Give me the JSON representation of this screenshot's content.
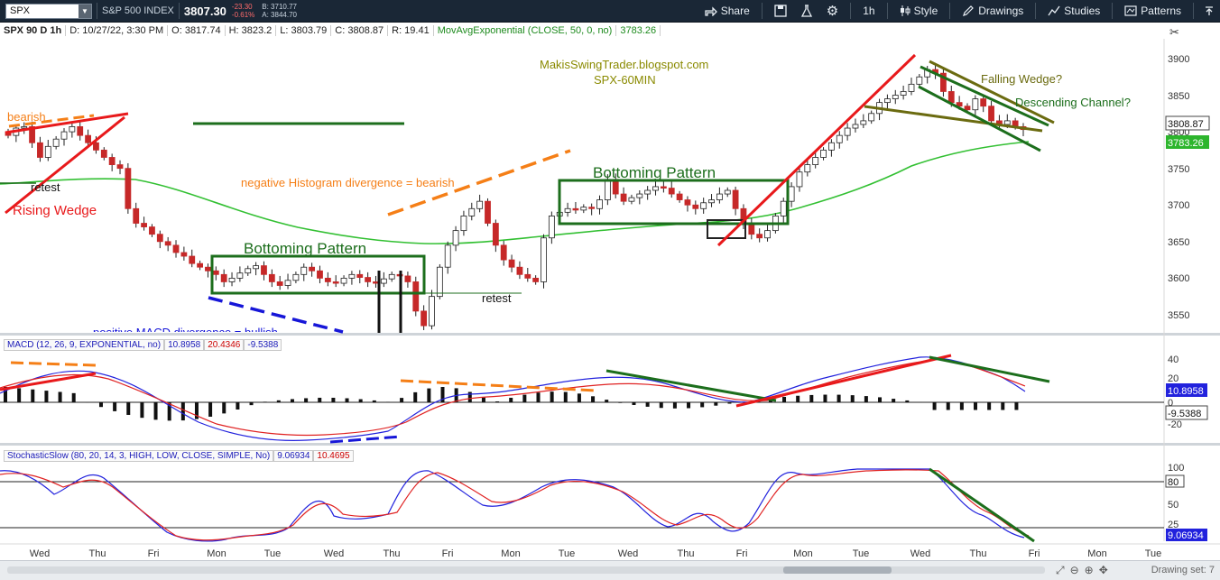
{
  "toolbar": {
    "symbol": "SPX",
    "instrument_name": "S&P 500 INDEX",
    "last_price": "3807.30",
    "change": "-23.30",
    "change_pct": "-0.61%",
    "bid": "B: 3710.77",
    "ask": "A: 3844.70",
    "buttons": {
      "share": "Share",
      "timeframe": "1h",
      "style": "Style",
      "drawings": "Drawings",
      "studies": "Studies",
      "patterns": "Patterns"
    },
    "icons": [
      "share-icon",
      "save-icon",
      "beaker-icon",
      "gear-icon",
      "candles-icon",
      "pencil-icon",
      "studies-icon",
      "patterns-icon",
      "collapse-icon"
    ]
  },
  "header": {
    "chart_spec": "SPX 90 D 1h",
    "date": "D: 10/27/22, 3:30 PM",
    "open": "O: 3817.74",
    "high": "H: 3823.2",
    "low": "L: 3803.79",
    "close": "C: 3808.87",
    "range": "R: 19.41",
    "ma_label": "MovAvgExponential (CLOSE, 50, 0, no)",
    "ma_value": "3783.26"
  },
  "price_pane": {
    "y_ticks": [
      "3900",
      "3850",
      "3800",
      "3750",
      "3700",
      "3650",
      "3600",
      "3550"
    ],
    "last_close_badge": "3808.87",
    "ma_badge": "3783.26",
    "annotations": {
      "blog": "MakisSwingTrader.blogspot.com",
      "subtitle": "SPX-60MIN",
      "bearish": "bearish",
      "retest_left": "retest",
      "rising_wedge": "Rising Wedge",
      "neg_hist_div": "negative Histogram divergence = bearish",
      "bottoming_1": "Bottoming Pattern",
      "bottoming_2": "Bottoming Pattern",
      "retest_right": "retest",
      "pos_macd_div": "positive MACD divergence = bullish",
      "falling_wedge": "Falling Wedge?",
      "desc_channel": "Descending Channel?"
    }
  },
  "macd_pane": {
    "label": "MACD (12, 26, 9, EXPONENTIAL, no)",
    "value1": "10.8958",
    "value2": "20.4346",
    "value3": "-9.5388",
    "y_ticks": [
      "40",
      "20",
      "0",
      "-20"
    ],
    "badge_macd": "10.8958",
    "badge_hist": "-9.5388"
  },
  "stoch_pane": {
    "label": "StochasticSlow (80, 20, 14, 3, HIGH, LOW, CLOSE, SIMPLE, No)",
    "value1": "9.06934",
    "value2": "10.4695",
    "y_ticks": [
      "100",
      "80",
      "50",
      "25"
    ],
    "badge": "9.06934"
  },
  "x_axis": [
    "Wed",
    "Thu",
    "Fri",
    "Mon",
    "Tue",
    "Wed",
    "Thu",
    "Fri",
    "Mon",
    "Tue",
    "Wed",
    "Thu",
    "Fri",
    "Mon",
    "Tue",
    "Wed",
    "Thu",
    "Fri",
    "Mon",
    "Tue"
  ],
  "bottom_bar": {
    "drawing_set": "Drawing set: 7"
  },
  "colors": {
    "toolbar_bg": "#1a2736",
    "up_candle": "#ffffff",
    "down_candle": "#c62828",
    "ema": "#33c033",
    "trend_red": "#e8191b",
    "trend_green": "#1c6e1c",
    "dash_orange": "#f57f17",
    "dash_blue": "#1616d8",
    "olive": "#6b6b10",
    "macd_line": "#2222dd",
    "signal_line": "#e02222"
  }
}
